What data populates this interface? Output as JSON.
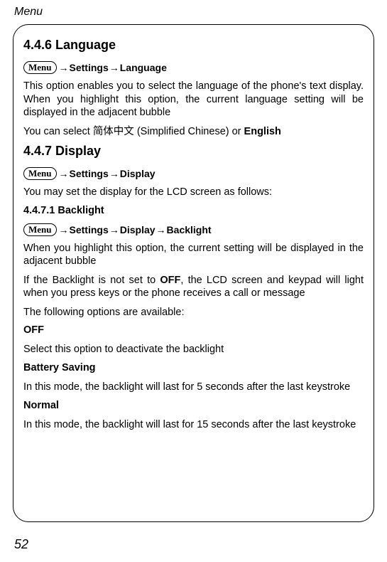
{
  "header": {
    "title": "Menu"
  },
  "sections": {
    "language": {
      "heading": "4.4.6 Language",
      "menu_label": "Menu",
      "path1": "Settings",
      "path2": "Language",
      "para1": "This option enables you to select the language of the phone's text display. When you highlight this option, the current language setting will be displayed in the adjacent bubble",
      "para2_pre": "You can select ",
      "para2_cn": "简体中文",
      "para2_mid": " (Simplified Chinese) or ",
      "para2_bold": "English"
    },
    "display": {
      "heading": "4.4.7 Display",
      "menu_label": "Menu",
      "path1": "Settings",
      "path2": "Display",
      "para1": "You may set the display for the LCD screen as follows:"
    },
    "backlight": {
      "heading": "4.4.7.1 Backlight",
      "menu_label": "Menu",
      "path1": "Settings",
      "path2": "Display",
      "path3": "Backlight",
      "para1": "When you highlight this option, the current setting will be displayed in the adjacent bubble",
      "para2_pre": "If the Backlight is not set to ",
      "para2_bold": "OFF",
      "para2_post": ", the LCD screen and keypad will light when you press keys or the phone receives a call or message",
      "para3": "The following options are available:",
      "opt_off_title": "OFF",
      "opt_off_body": "Select this option to deactivate the backlight",
      "opt_batt_title": "Battery Saving",
      "opt_batt_body": "In this mode, the backlight will last for 5 seconds after the last keystroke",
      "opt_norm_title": "Normal",
      "opt_norm_body": "In this mode, the backlight will last for 15 seconds after the last keystroke"
    }
  },
  "arrows": {
    "r": "→"
  },
  "page_number": "52"
}
